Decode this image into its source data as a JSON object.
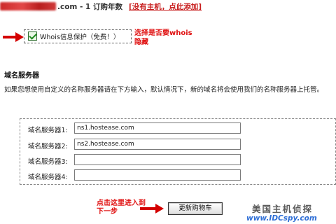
{
  "domain_line": {
    "suffix": ".com - 1 订购年数",
    "add_host_link": "[没有主机，点此添加]"
  },
  "whois": {
    "checked": true,
    "label": "Whois信息保护（免费！）",
    "annotation": "选择是否要whois隐藏"
  },
  "nameservers": {
    "heading": "域名服务器",
    "description": "如果您想使用自定义的名称服务器请在下方输入，默认情况下，新的域名将会使用我们的名称服务器上托管。",
    "fields": [
      {
        "label": "域名服务器1:",
        "value": "ns1.hostease.com"
      },
      {
        "label": "域名服务器2:",
        "value": "ns2.hostease.com"
      },
      {
        "label": "域名服务器3:",
        "value": ""
      },
      {
        "label": "域名服务器4:",
        "value": ""
      }
    ]
  },
  "footer": {
    "annotation": "点击这里进入到下一步",
    "update_button": "更新购物车"
  },
  "watermark": {
    "title": "美国主机侦探",
    "url": "www.IDCspy.com"
  },
  "colors": {
    "annotation_red": "#e01010",
    "arrow_red": "#d40000",
    "link_red": "#c81e1e",
    "watermark_blue": "#2f6fd6"
  }
}
